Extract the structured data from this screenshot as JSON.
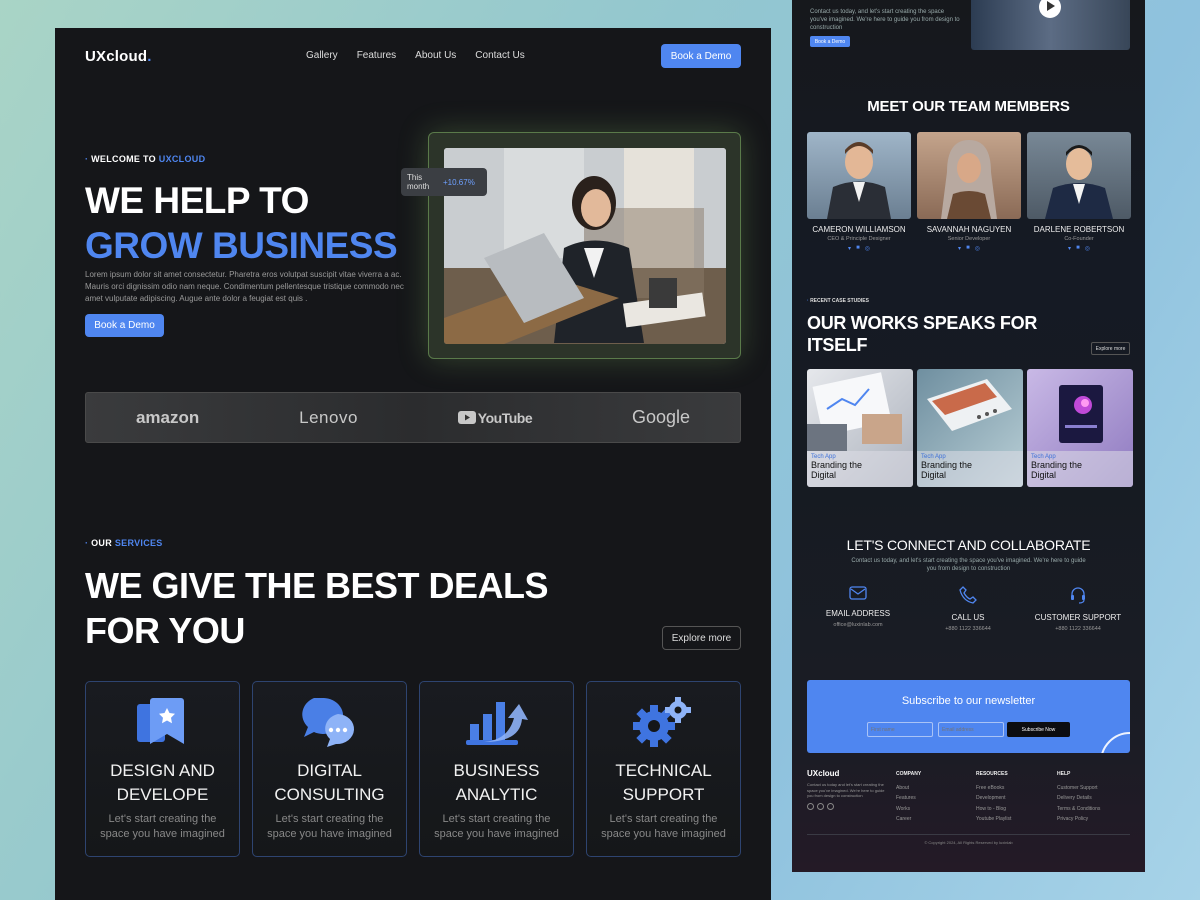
{
  "left": {
    "logo": "UXcloud",
    "logo_dot": ".",
    "nav": [
      "Gallery",
      "Features",
      "About Us",
      "Contact Us"
    ],
    "book_demo": "Book a Demo",
    "hero": {
      "eyebrow_1": "WELCOME TO",
      "eyebrow_2": "UXCLOUD",
      "title_1": "WE HELP TO",
      "title_2": "GROW BUSINESS",
      "paragraph": "Lorem ipsum dolor sit amet consectetur. Pharetra eros volutpat suscipit vitae viverra a ac. Mauris orci dignissim odio nam neque. Condimentum pellentesque tristique commodo nec amet vulputate adipiscing. Augue ante dolor a feugiat est quis .",
      "cta": "Book a Demo",
      "stat_label": "This month",
      "stat_value": "+10.67%"
    },
    "brands": [
      "amazon",
      "Lenovo",
      "YouTube",
      "Google"
    ],
    "services": {
      "eyebrow_1": "OUR",
      "eyebrow_2": "SERVICES",
      "title_1": "WE GIVE THE BEST DEALS",
      "title_2": "FOR YOU",
      "explore": "Explore more",
      "cards": [
        {
          "title_1": "DESIGN AND",
          "title_2": "DEVELOPE",
          "desc_1": "Let's start creating the",
          "desc_2": "space you have imagined",
          "icon": "bookmark-star-icon"
        },
        {
          "title_1": "DIGITAL",
          "title_2": "CONSULTING",
          "desc_1": "Let's start creating the",
          "desc_2": "space you have imagined",
          "icon": "chat-bubbles-icon"
        },
        {
          "title_1": "BUSINESS",
          "title_2": "ANALYTIC",
          "desc_1": "Let's start creating the",
          "desc_2": "space you have imagined",
          "icon": "bar-chart-arrow-icon"
        },
        {
          "title_1": "TECHNICAL",
          "title_2": "SUPPORT",
          "desc_1": "Let's start creating the",
          "desc_2": "space you have imagined",
          "icon": "gears-icon"
        }
      ]
    }
  },
  "right": {
    "top_text": "Contact us today, and let's start creating the space you've imagined. We're here to guide you from design to construction",
    "top_button": "Book a Demo",
    "team_title": "MEET OUR TEAM MEMBERS",
    "team": [
      {
        "name": "CAMERON WILLIAMSON",
        "role": "CEO & Principle Designer"
      },
      {
        "name": "SAVANNAH NAGUYEN",
        "role": "Senior Developer"
      },
      {
        "name": "DARLENE ROBERTSON",
        "role": "Co-Founder"
      }
    ],
    "cases_eyebrow": "RECENT CASE STUDIES",
    "cases_title_1": "OUR WORKS SPEAKS FOR",
    "cases_title_2": "ITSELF",
    "cases_explore": "Explore more",
    "works": [
      {
        "cat": "Tech App",
        "title_1": "Branding the",
        "title_2": "Digital"
      },
      {
        "cat": "Tech App",
        "title_1": "Branding the",
        "title_2": "Digital"
      },
      {
        "cat": "Tech App",
        "title_1": "Branding the",
        "title_2": "Digital"
      }
    ],
    "connect_title": "LET'S CONNECT AND COLLABORATE",
    "connect_sub_1": "Contact us today, and let's start creating the space you've imagined. We're here to guide",
    "connect_sub_2": "you from design to construction",
    "contacts": [
      {
        "label": "EMAIL ADDRESS",
        "value": "office@luxinlab.com",
        "icon": "mail-icon"
      },
      {
        "label": "CALL US",
        "value": "+880 1122 336644",
        "icon": "phone-icon"
      },
      {
        "label": "CUSTOMER SUPPORT",
        "value": "+880 1122 336644",
        "icon": "headset-icon"
      }
    ],
    "newsletter": {
      "title": "Subscribe to our newsletter",
      "first_name_placeholder": "First name",
      "email_placeholder": "Email address",
      "button": "Subscribe Now"
    },
    "footer": {
      "logo": "UXcloud",
      "about": "Contact us today and let's start creating the space you've imagined. We're here to guide you from design to construction",
      "columns": [
        {
          "title": "COMPANY",
          "items": [
            "About",
            "Features",
            "Works",
            "Career"
          ]
        },
        {
          "title": "RESOURCES",
          "items": [
            "Free eBooks",
            "Development",
            "How to - Blog",
            "Youtube Playlist"
          ]
        },
        {
          "title": "HELP",
          "items": [
            "Customer Support",
            "Delivery Details",
            "Terms & Conditions",
            "Privacy Policy"
          ]
        }
      ],
      "copyright": "© Copyright 2024, All Rights Reserved by luxinlab"
    }
  }
}
